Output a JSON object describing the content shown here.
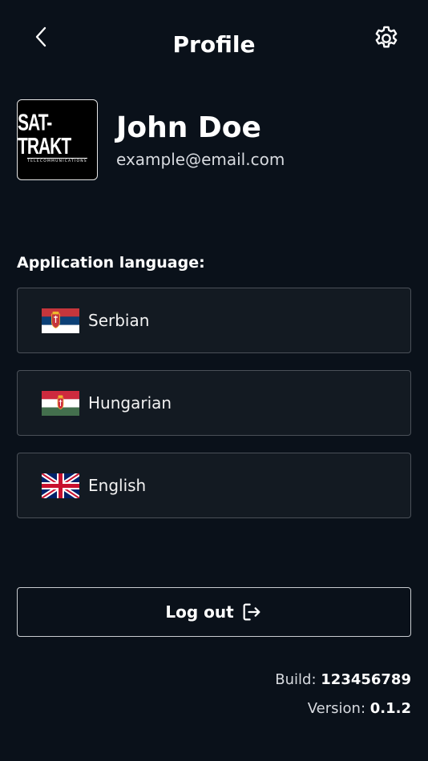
{
  "header": {
    "title": "Profile",
    "back_icon": "chevron-left-icon",
    "settings_icon": "gear-icon"
  },
  "profile": {
    "logo_text": "SAT-TRAKT",
    "logo_subtext": "TELECOMMUNICATIONS",
    "name": "John Doe",
    "email": "example@email.com"
  },
  "language": {
    "label": "Application language:",
    "options": [
      {
        "label": "Serbian",
        "flag_icon": "serbia-flag-icon"
      },
      {
        "label": "Hungarian",
        "flag_icon": "hungary-flag-icon"
      },
      {
        "label": "English",
        "flag_icon": "uk-flag-icon"
      }
    ]
  },
  "logout": {
    "label": "Log out",
    "icon": "logout-icon"
  },
  "meta": {
    "build_label": "Build:",
    "build_value": "123456789",
    "version_label": "Version:",
    "version_value": "0.1.2"
  },
  "colors": {
    "background": "#0a111a",
    "card": "#131a22",
    "card_border": "#4a5058",
    "text": "#ffffff",
    "muted_text": "#d8dbe0"
  }
}
